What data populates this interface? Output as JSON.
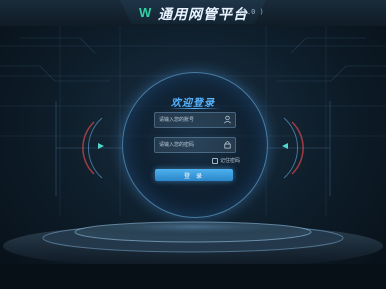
{
  "header": {
    "logo": "W",
    "title": "通用网管平台",
    "version": "( V1.0 )"
  },
  "login": {
    "welcome": "欢迎登录",
    "account_placeholder": "请输入您的账号",
    "password_placeholder": "请输入您的密码",
    "remember_label": "记住密码",
    "submit_label": "登 录"
  },
  "colors": {
    "accent": "#58b4ff",
    "button": "#3a9ee0",
    "logo": "#2fd0a4"
  }
}
